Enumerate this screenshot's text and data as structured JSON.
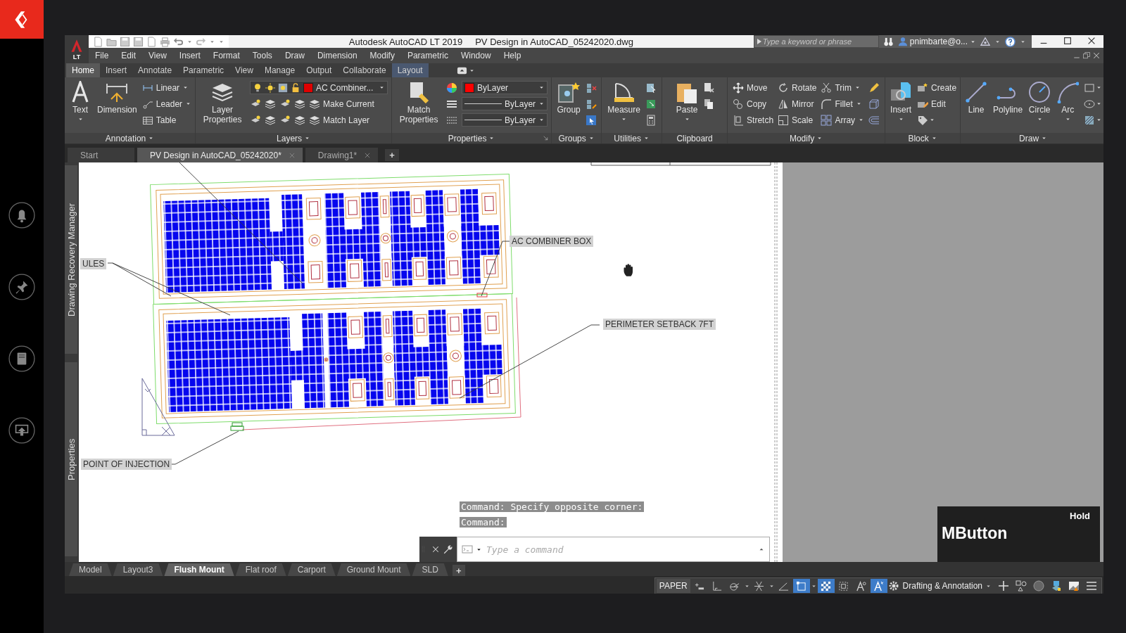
{
  "title_bar": {
    "badge": "LT",
    "app": "Autodesk AutoCAD LT 2019",
    "document": "PV Design in AutoCAD_05242020.dwg",
    "search_placeholder": "Type a keyword or phrase",
    "user": "pnimbarte@o..."
  },
  "menu": [
    "File",
    "Edit",
    "View",
    "Insert",
    "Format",
    "Tools",
    "Draw",
    "Dimension",
    "Modify",
    "Parametric",
    "Window",
    "Help"
  ],
  "ribbon_tabs": [
    {
      "label": "Home",
      "selected": true,
      "contextual": false
    },
    {
      "label": "Insert",
      "selected": false,
      "contextual": false
    },
    {
      "label": "Annotate",
      "selected": false,
      "contextual": false
    },
    {
      "label": "Parametric",
      "selected": false,
      "contextual": false
    },
    {
      "label": "View",
      "selected": false,
      "contextual": false
    },
    {
      "label": "Manage",
      "selected": false,
      "contextual": false
    },
    {
      "label": "Output",
      "selected": false,
      "contextual": false
    },
    {
      "label": "Collaborate",
      "selected": false,
      "contextual": false
    },
    {
      "label": "Layout",
      "selected": false,
      "contextual": true
    }
  ],
  "ribbon_panels": [
    {
      "title": "Annotation",
      "menu": true,
      "launcher": false,
      "columns": [
        [
          {
            "kind": "large",
            "label": "Text",
            "menu": true
          }
        ],
        [
          {
            "kind": "large",
            "label": "Dimension",
            "menu": false
          }
        ],
        [
          {
            "kind": "small",
            "label": "Linear",
            "menu": true
          },
          {
            "kind": "small",
            "label": "Leader",
            "menu": true
          },
          {
            "kind": "small",
            "label": "Table",
            "menu": false
          }
        ]
      ]
    },
    {
      "title": "Layers",
      "menu": true,
      "launcher": false,
      "columns": [
        [
          {
            "kind": "large",
            "label": "Layer Properties",
            "menu": false
          }
        ],
        [
          {
            "kind": "layer-combo",
            "value": "AC Combiner...",
            "color": "#e00000"
          },
          {
            "kind": "layer-tool",
            "label": "Make Current"
          },
          {
            "kind": "layer-tool",
            "label": "Match Layer"
          }
        ]
      ]
    },
    {
      "title": "Properties",
      "menu": true,
      "launcher": true,
      "columns": [
        [
          {
            "kind": "large",
            "label": "Match Properties",
            "menu": false
          }
        ],
        [
          {
            "kind": "icon",
            "menu": false
          },
          {
            "kind": "icon",
            "menu": false
          },
          {
            "kind": "icon",
            "menu": false
          }
        ],
        [
          {
            "kind": "combo",
            "value": "ByLayer",
            "color": "#ff0000"
          },
          {
            "kind": "line-combo",
            "value": "ByLayer"
          },
          {
            "kind": "line-combo",
            "value": "ByLayer"
          }
        ]
      ]
    },
    {
      "title": "Groups",
      "menu": true,
      "launcher": false,
      "columns": [
        [
          {
            "kind": "large",
            "label": "Group",
            "menu": false
          }
        ],
        [
          {
            "kind": "icon",
            "menu": false
          },
          {
            "kind": "icon",
            "menu": false
          },
          {
            "kind": "icon",
            "menu": false
          }
        ]
      ]
    },
    {
      "title": "Utilities",
      "menu": true,
      "launcher": false,
      "columns": [
        [
          {
            "kind": "large",
            "label": "Measure",
            "menu": true
          }
        ],
        [
          {
            "kind": "icon",
            "menu": false
          },
          {
            "kind": "icon",
            "menu": false
          },
          {
            "kind": "icon",
            "menu": false
          }
        ]
      ]
    },
    {
      "title": "Clipboard",
      "menu": false,
      "launcher": false,
      "columns": [
        [
          {
            "kind": "large",
            "label": "Paste",
            "menu": true
          }
        ],
        [
          {
            "kind": "icon",
            "menu": false
          },
          {
            "kind": "icon",
            "menu": false
          }
        ]
      ]
    },
    {
      "title": "Modify",
      "menu": true,
      "launcher": false,
      "columns": [
        [
          {
            "kind": "small",
            "label": "Move",
            "menu": false
          },
          {
            "kind": "small",
            "label": "Copy",
            "menu": false
          },
          {
            "kind": "small",
            "label": "Stretch",
            "menu": false
          }
        ],
        [
          {
            "kind": "small",
            "label": "Rotate",
            "menu": false
          },
          {
            "kind": "small",
            "label": "Mirror",
            "menu": false
          },
          {
            "kind": "small",
            "label": "Scale",
            "menu": false
          }
        ],
        [
          {
            "kind": "small",
            "label": "Trim",
            "menu": true
          },
          {
            "kind": "small",
            "label": "Fillet",
            "menu": true
          },
          {
            "kind": "small",
            "label": "Array",
            "menu": true
          }
        ],
        [
          {
            "kind": "icon",
            "menu": false
          },
          {
            "kind": "icon",
            "menu": false
          },
          {
            "kind": "icon",
            "menu": false
          }
        ]
      ]
    },
    {
      "title": "Block",
      "menu": true,
      "launcher": false,
      "columns": [
        [
          {
            "kind": "large",
            "label": "Insert",
            "menu": true
          }
        ],
        [
          {
            "kind": "small",
            "label": "Create",
            "menu": false
          },
          {
            "kind": "small",
            "label": "Edit",
            "menu": false
          },
          {
            "kind": "icon",
            "menu": true
          }
        ]
      ]
    },
    {
      "title": "Draw",
      "menu": true,
      "launcher": false,
      "columns": [
        [
          {
            "kind": "large",
            "label": "Line",
            "menu": false
          }
        ],
        [
          {
            "kind": "large",
            "label": "Polyline",
            "menu": false
          }
        ],
        [
          {
            "kind": "large",
            "label": "Circle",
            "menu": true
          }
        ],
        [
          {
            "kind": "large",
            "label": "Arc",
            "menu": true
          }
        ],
        [
          {
            "kind": "icon",
            "menu": true
          },
          {
            "kind": "icon",
            "menu": true
          },
          {
            "kind": "icon",
            "menu": true
          }
        ]
      ]
    }
  ],
  "doc_tabs": [
    {
      "label": "Start",
      "selected": false,
      "closable": false
    },
    {
      "label": "PV Design in AutoCAD_05242020*",
      "selected": true,
      "closable": true
    },
    {
      "label": "Drawing1*",
      "selected": false,
      "closable": true
    }
  ],
  "new_tab": "+",
  "palettes": [
    "Drawing Recovery Manager",
    "Properties"
  ],
  "callouts": [
    "ULES",
    "AC COMBINER BOX",
    "PERIMETER SETBACK 7FT",
    "POINT OF INJECTION"
  ],
  "command_line": {
    "history": [
      "Command: Specify opposite corner:",
      "Command:"
    ],
    "placeholder": "Type a command"
  },
  "layout_tabs": [
    {
      "label": "Model",
      "selected": false
    },
    {
      "label": "Layout3",
      "selected": false
    },
    {
      "label": "Flush Mount",
      "selected": true
    },
    {
      "label": "Flat roof",
      "selected": false
    },
    {
      "label": "Carport",
      "selected": false
    },
    {
      "label": "Ground Mount",
      "selected": false
    },
    {
      "label": "SLD",
      "selected": false
    }
  ],
  "new_layout": "+",
  "status_bar": {
    "space": "PAPER",
    "toggles": [
      {
        "on": false
      },
      {
        "on": false
      },
      {
        "on": false
      },
      {
        "on": false
      },
      {
        "on": false
      },
      {
        "on": true
      },
      {
        "on": true
      },
      {
        "on": false
      },
      {
        "on": false
      },
      {
        "on": true
      }
    ],
    "workspace": "Drafting & Annotation"
  },
  "mouse_hint": {
    "hint": "Hold",
    "button": "MButton"
  }
}
